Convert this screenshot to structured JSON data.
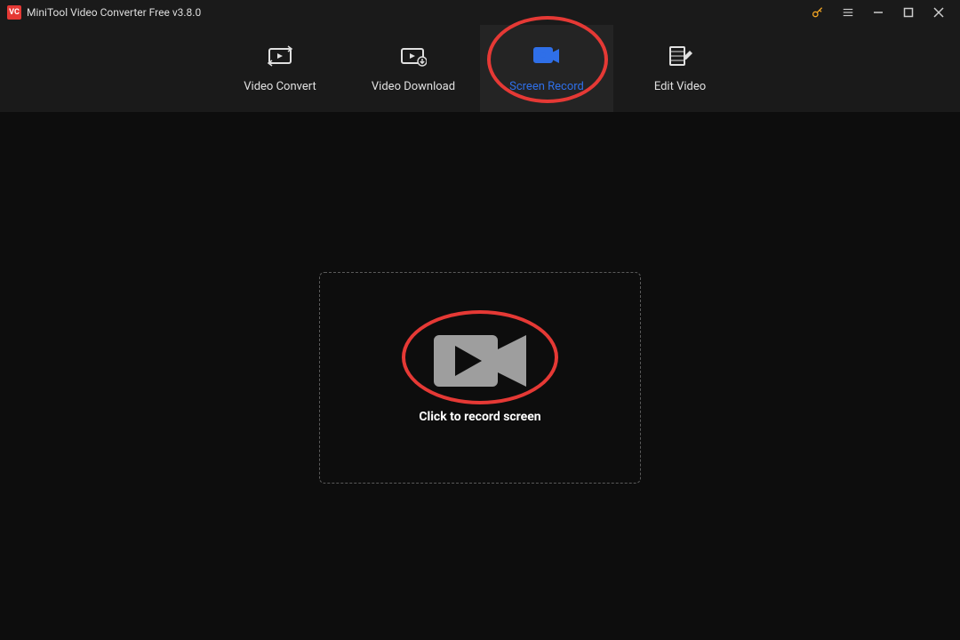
{
  "titlebar": {
    "app_name": "MiniTool Video Converter Free v3.8.0"
  },
  "nav": {
    "items": [
      {
        "label": "Video Convert"
      },
      {
        "label": "Video Download"
      },
      {
        "label": "Screen Record"
      },
      {
        "label": "Edit Video"
      }
    ]
  },
  "main": {
    "record_prompt": "Click to record screen"
  }
}
